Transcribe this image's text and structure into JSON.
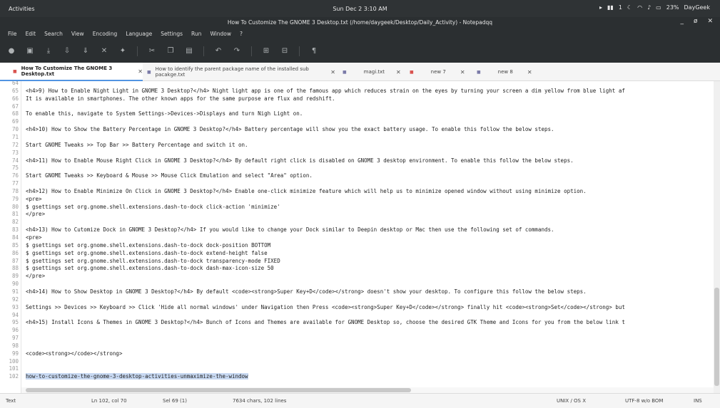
{
  "topbar": {
    "activities": "Activities",
    "clock": "Sun Dec 2  3:10 AM",
    "tray_1": "1",
    "battery": "23%",
    "user": "DayGeek"
  },
  "window": {
    "title": "How To Customize The GNOME 3 Desktop.txt (/home/daygeek/Desktop/Daily_Activity) - Notepadqq",
    "minimize": "_",
    "maximize": "ø",
    "close": "✕"
  },
  "menu": [
    "File",
    "Edit",
    "Search",
    "View",
    "Encoding",
    "Language",
    "Settings",
    "Run",
    "Window",
    "?"
  ],
  "toolbar_icons": [
    "new-file-icon",
    "open-file-icon",
    "save-icon",
    "save-all-icon",
    "close-file-icon",
    "print-icon",
    "cut-icon",
    "copy-icon",
    "paste-icon",
    "undo-icon",
    "redo-icon",
    "zoom-in-icon",
    "zoom-out-icon",
    "word-wrap-icon"
  ],
  "tabs": [
    {
      "label": "How To Customize The GNOME 3 Desktop.txt",
      "active": true
    },
    {
      "label": "How to identify the parent package name of the installed sub pacakge.txt",
      "active": false
    },
    {
      "label": "magi.txt",
      "active": false
    },
    {
      "label": "new 7",
      "active": false
    },
    {
      "label": "new 8",
      "active": false
    }
  ],
  "editor": {
    "lines": [
      {
        "n": "64",
        "t": ""
      },
      {
        "n": "65",
        "t": "<h4>9) How to Enable Night Light in GNOME 3 Desktop?</h4> Night light app is one of the famous app which reduces strain on the eyes by turning your screen a dim yellow from blue light af"
      },
      {
        "n": "66",
        "t": "It is available in smartphones. The other known apps for the same purpose are flux and redshift."
      },
      {
        "n": "67",
        "t": ""
      },
      {
        "n": "68",
        "t": "To enable this, navigate to System Settings->Devices->Displays and turn Nigh Light on."
      },
      {
        "n": "69",
        "t": ""
      },
      {
        "n": "70",
        "t": "<h4>10) How to Show the Battery Percentage in GNOME 3 Desktop?</h4> Battery percentage will show you the exact battery usage. To enable this follow the below steps."
      },
      {
        "n": "71",
        "t": ""
      },
      {
        "n": "72",
        "t": "Start GNOME Tweaks >> Top Bar >> Battery Percentage and switch it on."
      },
      {
        "n": "73",
        "t": ""
      },
      {
        "n": "74",
        "t": "<h4>11) How to Enable Mouse Right Click in GNOME 3 Desktop?</h4> By default right click is disabled on GNOME 3 desktop environment. To enable this follow the below steps."
      },
      {
        "n": "75",
        "t": ""
      },
      {
        "n": "76",
        "t": "Start GNOME Tweaks >> Keyboard & Mouse >> Mouse Click Emulation and select \"Area\" option."
      },
      {
        "n": "77",
        "t": ""
      },
      {
        "n": "78",
        "t": "<h4>12) How to Enable Minimize On Click in GNOME 3 Desktop?</h4> Enable one-click minimize feature which will help us to minimize opened window without using minimize option."
      },
      {
        "n": "79",
        "t": "<pre>"
      },
      {
        "n": "80",
        "t": "$ gsettings set org.gnome.shell.extensions.dash-to-dock click-action 'minimize'"
      },
      {
        "n": "81",
        "t": "</pre>"
      },
      {
        "n": "82",
        "t": ""
      },
      {
        "n": "83",
        "t": "<h4>13) How to Cutomize Dock in GNOME 3 Desktop?</h4> If you would like to change your Dock similar to Deepin desktop or Mac then use the following set of commands."
      },
      {
        "n": "84",
        "t": "<pre>"
      },
      {
        "n": "85",
        "t": "$ gsettings set org.gnome.shell.extensions.dash-to-dock dock-position BOTTOM"
      },
      {
        "n": "86",
        "t": "$ gsettings set org.gnome.shell.extensions.dash-to-dock extend-height false"
      },
      {
        "n": "87",
        "t": "$ gsettings set org.gnome.shell.extensions.dash-to-dock transparency-mode FIXED"
      },
      {
        "n": "88",
        "t": "$ gsettings set org.gnome.shell.extensions.dash-to-dock dash-max-icon-size 50"
      },
      {
        "n": "89",
        "t": "</pre>"
      },
      {
        "n": "90",
        "t": ""
      },
      {
        "n": "91",
        "t": "<h4>14) How to Show Desktop in GNOME 3 Desktop?</h4> By default <code><strong>Super Key+D</code></strong> doesn't show your desktop. To configure this follow the below steps."
      },
      {
        "n": "92",
        "t": ""
      },
      {
        "n": "93",
        "t": "Settings >> Devices >> Keyboard >> Click 'Hide all normal windows' under Navigation then Press <code><strong>Super Key+D</code></strong> finally hit <code><strong>Set</code></strong> but"
      },
      {
        "n": "94",
        "t": ""
      },
      {
        "n": "95",
        "t": "<h4>15) Install Icons & Themes in GNOME 3 Desktop?</h4> Bunch of Icons and Themes are available for GNOME Desktop so, choose the desired GTK Theme and Icons for you from the below link t"
      },
      {
        "n": "96",
        "t": ""
      },
      {
        "n": "97",
        "t": ""
      },
      {
        "n": "98",
        "t": ""
      },
      {
        "n": "99",
        "t": "<code><strong></code></strong>"
      },
      {
        "n": "100",
        "t": ""
      },
      {
        "n": "101",
        "t": ""
      },
      {
        "n": "102",
        "t": "how-to-customize-the-gnome-3-desktop-activities-unmaximize-the-window",
        "selected": true
      }
    ]
  },
  "status": {
    "language": "Text",
    "cursor": "Ln 102, col 70",
    "selection": "Sel 69 (1)",
    "counts": "7634 chars, 102 lines",
    "eol": "UNIX / OS X",
    "encoding": "UTF-8 w/o BOM",
    "mode": "INS"
  }
}
